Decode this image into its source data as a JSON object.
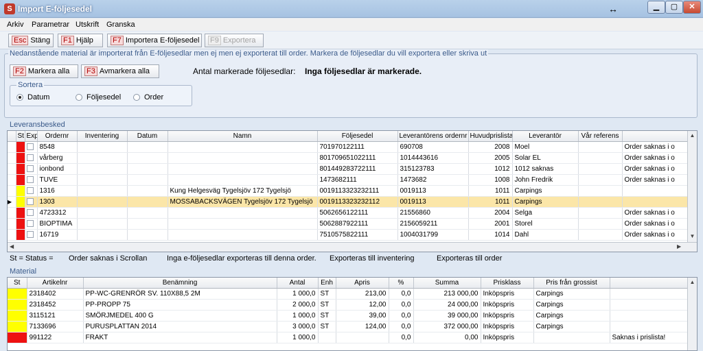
{
  "window": {
    "title": "Import E-följesedel",
    "icon": "app-logo-icon",
    "resize_icon": "↔",
    "min": "▁",
    "max": "▢",
    "close": "✕"
  },
  "menu": [
    "Arkiv",
    "Parametrar",
    "Utskrift",
    "Granska"
  ],
  "toolbar": [
    {
      "key": "Esc",
      "label": "Stäng",
      "enabled": true
    },
    {
      "key": "F1",
      "label": "Hjälp",
      "enabled": true
    },
    {
      "key": "F7",
      "label": "Importera E-följesedel",
      "enabled": true
    },
    {
      "key": "F9",
      "label": "Exportera",
      "enabled": false
    }
  ],
  "info": "Nedanstående material är importerat från E-följesedlar men ej  men ej exporterat till order. Markera de följesedlar du vill exportera eller skriva ut",
  "mark": {
    "key": "F2",
    "label": "Markera alla"
  },
  "unmark": {
    "key": "F3",
    "label": "Avmarkera alla"
  },
  "count_label": "Antal markerade följesedlar:",
  "count_value": "Inga följesedlar är markerade.",
  "sort": {
    "title": "Sortera",
    "options": [
      "Datum",
      "Följesedel",
      "Order"
    ],
    "selected": 0
  },
  "deliveries": {
    "title": "Leveransbesked",
    "columns": [
      "St",
      "Exp",
      "Ordernr",
      "Inventering",
      "Datum",
      "Namn",
      "Följesedel",
      "Leverantörens ordernr",
      "Huvudprislista",
      "Leverantör",
      "Vår referens",
      ""
    ],
    "rows": [
      {
        "st": "red",
        "ordernr": "8548",
        "inv": "",
        "datum": "",
        "namn": "",
        "foljesedel": "701970122111",
        "levorder": "690708",
        "pris": "2008",
        "lev": "Moel",
        "ref": "",
        "msg": "Order saknas i o"
      },
      {
        "st": "red",
        "ordernr": "vårberg",
        "inv": "",
        "datum": "",
        "namn": "",
        "foljesedel": "801709651022111",
        "levorder": "1014443616",
        "pris": "2005",
        "lev": "Solar EL",
        "ref": "",
        "msg": "Order saknas i o"
      },
      {
        "st": "red",
        "ordernr": "ionbond",
        "inv": "",
        "datum": "",
        "namn": "",
        "foljesedel": "801449283722111",
        "levorder": "315123783",
        "pris": "1012",
        "lev": "1012 saknas",
        "ref": "",
        "msg": "Order saknas i o"
      },
      {
        "st": "red",
        "ordernr": "TUVE",
        "inv": "",
        "datum": "",
        "namn": "",
        "foljesedel": "1473682111",
        "levorder": "1473682",
        "pris": "1008",
        "lev": "John Fredrik",
        "ref": "",
        "msg": "Order saknas i o"
      },
      {
        "st": "yellow",
        "ordernr": "1316",
        "inv": "",
        "datum": "",
        "namn": "Kung Helgesväg Tygelsjöv 172 Tygelsjö",
        "foljesedel": "0019113323232111",
        "levorder": "0019113",
        "pris": "1011",
        "lev": "Carpings",
        "ref": "",
        "msg": ""
      },
      {
        "st": "yellow",
        "ordernr": "1303",
        "inv": "",
        "datum": "",
        "namn": "MOSSABACKSVÄGEN Tygelsjöv 172 Tygelsjö",
        "foljesedel": "0019113323232112",
        "levorder": "0019113",
        "pris": "1011",
        "lev": "Carpings",
        "ref": "",
        "msg": "",
        "selected": true
      },
      {
        "st": "red",
        "ordernr": "4723312",
        "inv": "",
        "datum": "",
        "namn": "",
        "foljesedel": "5062656122111",
        "levorder": "21556860",
        "pris": "2004",
        "lev": "Selga",
        "ref": "",
        "msg": "Order saknas i o"
      },
      {
        "st": "red",
        "ordernr": "BIOPTIMA",
        "inv": "",
        "datum": "",
        "namn": "",
        "foljesedel": "5062887922111",
        "levorder": "2156059211",
        "pris": "2001",
        "lev": "Storel",
        "ref": "",
        "msg": "Order saknas i o"
      },
      {
        "st": "red",
        "ordernr": "16719",
        "inv": "",
        "datum": "",
        "namn": "",
        "foljesedel": "7510575822111",
        "levorder": "1004031799",
        "pris": "1014",
        "lev": "Dahl",
        "ref": "",
        "msg": "Order saknas i o"
      }
    ]
  },
  "legend": [
    "St = Status =",
    "Order saknas i Scrollan",
    "Inga e-följesedlar exporteras till denna order.",
    "Exporteras till inventering",
    "Exporteras till order"
  ],
  "material": {
    "title": "Material",
    "columns": [
      "St",
      "Artikelnr",
      "Benämning",
      "Antal",
      "Enh",
      "Apris",
      "%",
      "Summa",
      "Prisklass",
      "Pris från grossist",
      ""
    ],
    "rows": [
      {
        "st": "yellow",
        "art": "2318402",
        "ben": "PP-WC-GRENRÖR SV. 110X88,5 2M",
        "antal": "1 000,0",
        "enh": "ST",
        "apris": "213,00",
        "pct": "0,0",
        "summa": "213 000,00",
        "klass": "Inköpspris",
        "grossist": "Carpings",
        "note": ""
      },
      {
        "st": "yellow",
        "art": "2318452",
        "ben": "PP-PROPP 75",
        "antal": "2 000,0",
        "enh": "ST",
        "apris": "12,00",
        "pct": "0,0",
        "summa": "24 000,00",
        "klass": "Inköpspris",
        "grossist": "Carpings",
        "note": ""
      },
      {
        "st": "yellow",
        "art": "3115121",
        "ben": "SMÖRJMEDEL 400 G",
        "antal": "1 000,0",
        "enh": "ST",
        "apris": "39,00",
        "pct": "0,0",
        "summa": "39 000,00",
        "klass": "Inköpspris",
        "grossist": "Carpings",
        "note": ""
      },
      {
        "st": "yellow",
        "art": "7133696",
        "ben": "PURUSPLATTAN 2014",
        "antal": "3 000,0",
        "enh": "ST",
        "apris": "124,00",
        "pct": "0,0",
        "summa": "372 000,00",
        "klass": "Inköpspris",
        "grossist": "Carpings",
        "note": ""
      },
      {
        "st": "red",
        "art": "991122",
        "ben": "FRAKT",
        "antal": "1 000,0",
        "enh": "",
        "apris": "",
        "pct": "0,0",
        "summa": "0,00",
        "klass": "Inköpspris",
        "grossist": "",
        "note": "Saknas i prislista!"
      }
    ]
  },
  "colors": {
    "red": "#ee1111",
    "yellow": "#ffff00",
    "selected": "#fbe6a8"
  }
}
